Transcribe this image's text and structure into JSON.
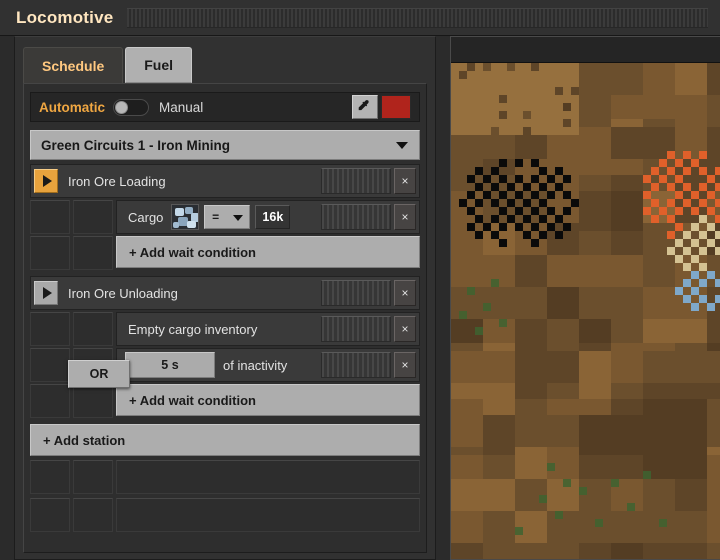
{
  "window": {
    "title": "Locomotive",
    "drag_handle": "window-drag-stripes"
  },
  "tabs": [
    {
      "label": "Schedule",
      "active": true
    },
    {
      "label": "Fuel",
      "active": false
    }
  ],
  "mode_bar": {
    "automatic_label": "Automatic",
    "manual_label": "Manual",
    "toggle_state": "automatic",
    "picker_icon": "eyedropper-icon",
    "color_swatch_hex": "#b0241c",
    "automatic_color": "#f0a742"
  },
  "schedule": {
    "selected_group": "Green Circuits 1 - Iron Mining",
    "caret_icon": "chevron-down-icon"
  },
  "stations": [
    {
      "name": "Iron Ore Loading",
      "play_state": "active",
      "conditions": [
        {
          "type": "cargo",
          "label": "Cargo",
          "item_icon": "iron-ore-icon",
          "comparator": "=",
          "count": "16k"
        }
      ],
      "add_condition_label": "+ Add wait condition"
    },
    {
      "name": "Iron Ore Unloading",
      "play_state": "inactive",
      "conditions": [
        {
          "type": "empty_inventory",
          "label": "Empty cargo inventory"
        },
        {
          "type": "inactivity",
          "time_value": "5 s",
          "label": "of inactivity",
          "joiner": "OR"
        }
      ],
      "add_condition_label": "+ Add wait condition"
    }
  ],
  "add_station_label": "+ Add station",
  "close_button_glyph": "×",
  "map": {
    "terrain_base_hex": "#6b4f2d",
    "ore_patches": [
      {
        "name": "coal",
        "color": "#0a0a0a"
      },
      {
        "name": "copper-ore",
        "color": "#e0602a"
      },
      {
        "name": "stone",
        "color": "#d4c292"
      },
      {
        "name": "water",
        "color": "#7fa8c9"
      }
    ],
    "tree_color": "#3e6330"
  }
}
